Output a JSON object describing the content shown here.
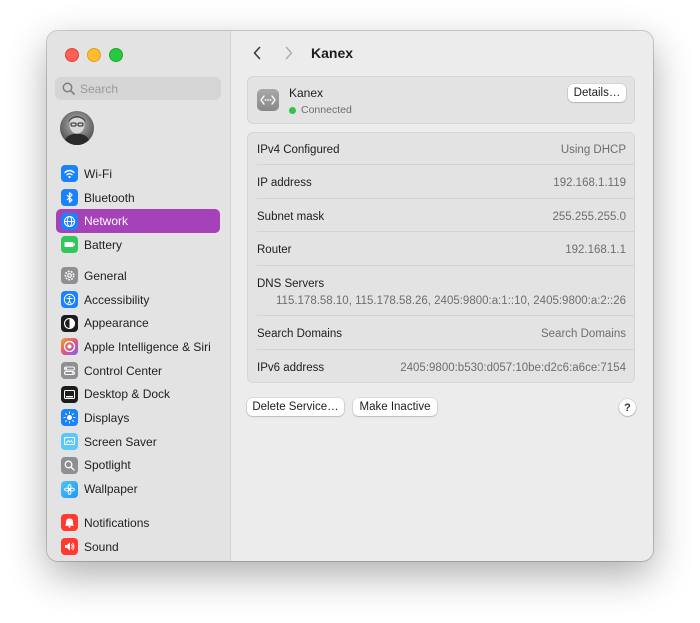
{
  "window": {
    "title": "Kanex",
    "controls": [
      "close",
      "minimize",
      "zoom"
    ]
  },
  "search": {
    "placeholder": "Search",
    "value": ""
  },
  "sidebar": {
    "accent": "#a642b8",
    "groups": [
      [
        {
          "label": "Wi-Fi",
          "icon": "wifi-icon",
          "color": "#1a82fb",
          "active": false
        },
        {
          "label": "Bluetooth",
          "icon": "bluetooth-icon",
          "color": "#1a82fb",
          "active": false
        },
        {
          "label": "Network",
          "icon": "network-globe-icon",
          "color": "#1a82fb",
          "active": true
        },
        {
          "label": "Battery",
          "icon": "battery-icon",
          "color": "#32c759",
          "active": false
        }
      ],
      [
        {
          "label": "General",
          "icon": "gear-icon",
          "color": "#8e8e93",
          "active": false
        },
        {
          "label": "Accessibility",
          "icon": "accessibility-icon",
          "color": "#1a82fb",
          "active": false
        },
        {
          "label": "Appearance",
          "icon": "appearance-icon",
          "color": "#1c1c1e",
          "active": false
        },
        {
          "label": "Apple Intelligence & Siri",
          "icon": "siri-icon",
          "color": "#e0567f",
          "active": false
        },
        {
          "label": "Control Center",
          "icon": "control-center-icon",
          "color": "#8e8e93",
          "active": false
        },
        {
          "label": "Desktop & Dock",
          "icon": "dock-icon",
          "color": "#1c1c1e",
          "active": false
        },
        {
          "label": "Displays",
          "icon": "displays-icon",
          "color": "#1a82fb",
          "active": false
        },
        {
          "label": "Screen Saver",
          "icon": "screen-saver-icon",
          "color": "#5ac8fa",
          "active": false
        },
        {
          "label": "Spotlight",
          "icon": "spotlight-icon",
          "color": "#8e8e93",
          "active": false
        },
        {
          "label": "Wallpaper",
          "icon": "wallpaper-icon",
          "color": "#34aadc",
          "active": false
        }
      ],
      [
        {
          "label": "Notifications",
          "icon": "notifications-icon",
          "color": "#ff3b30",
          "active": false
        },
        {
          "label": "Sound",
          "icon": "sound-icon",
          "color": "#ff3b30",
          "active": false
        }
      ]
    ]
  },
  "service": {
    "name": "Kanex",
    "status": "Connected",
    "status_color": "#31c24a",
    "details_label": "Details…"
  },
  "info": {
    "ipv4_label": "IPv4 Configured",
    "ipv4_value": "Using DHCP",
    "ip_label": "IP address",
    "ip_value": "192.168.1.119",
    "subnet_label": "Subnet mask",
    "subnet_value": "255.255.255.0",
    "router_label": "Router",
    "router_value": "192.168.1.1",
    "dns_label": "DNS Servers",
    "dns_value": "115.178.58.10, 115.178.58.26, 2405:9800:a:1::10, 2405:9800:a:2::26",
    "search_domains_label": "Search Domains",
    "search_domains_value": "Search Domains",
    "ipv6_label": "IPv6 address",
    "ipv6_value": "2405:9800:b530:d057:10be:d2c6:a6ce:7154"
  },
  "actions": {
    "delete_label": "Delete Service…",
    "inactive_label": "Make Inactive",
    "help_label": "?"
  }
}
